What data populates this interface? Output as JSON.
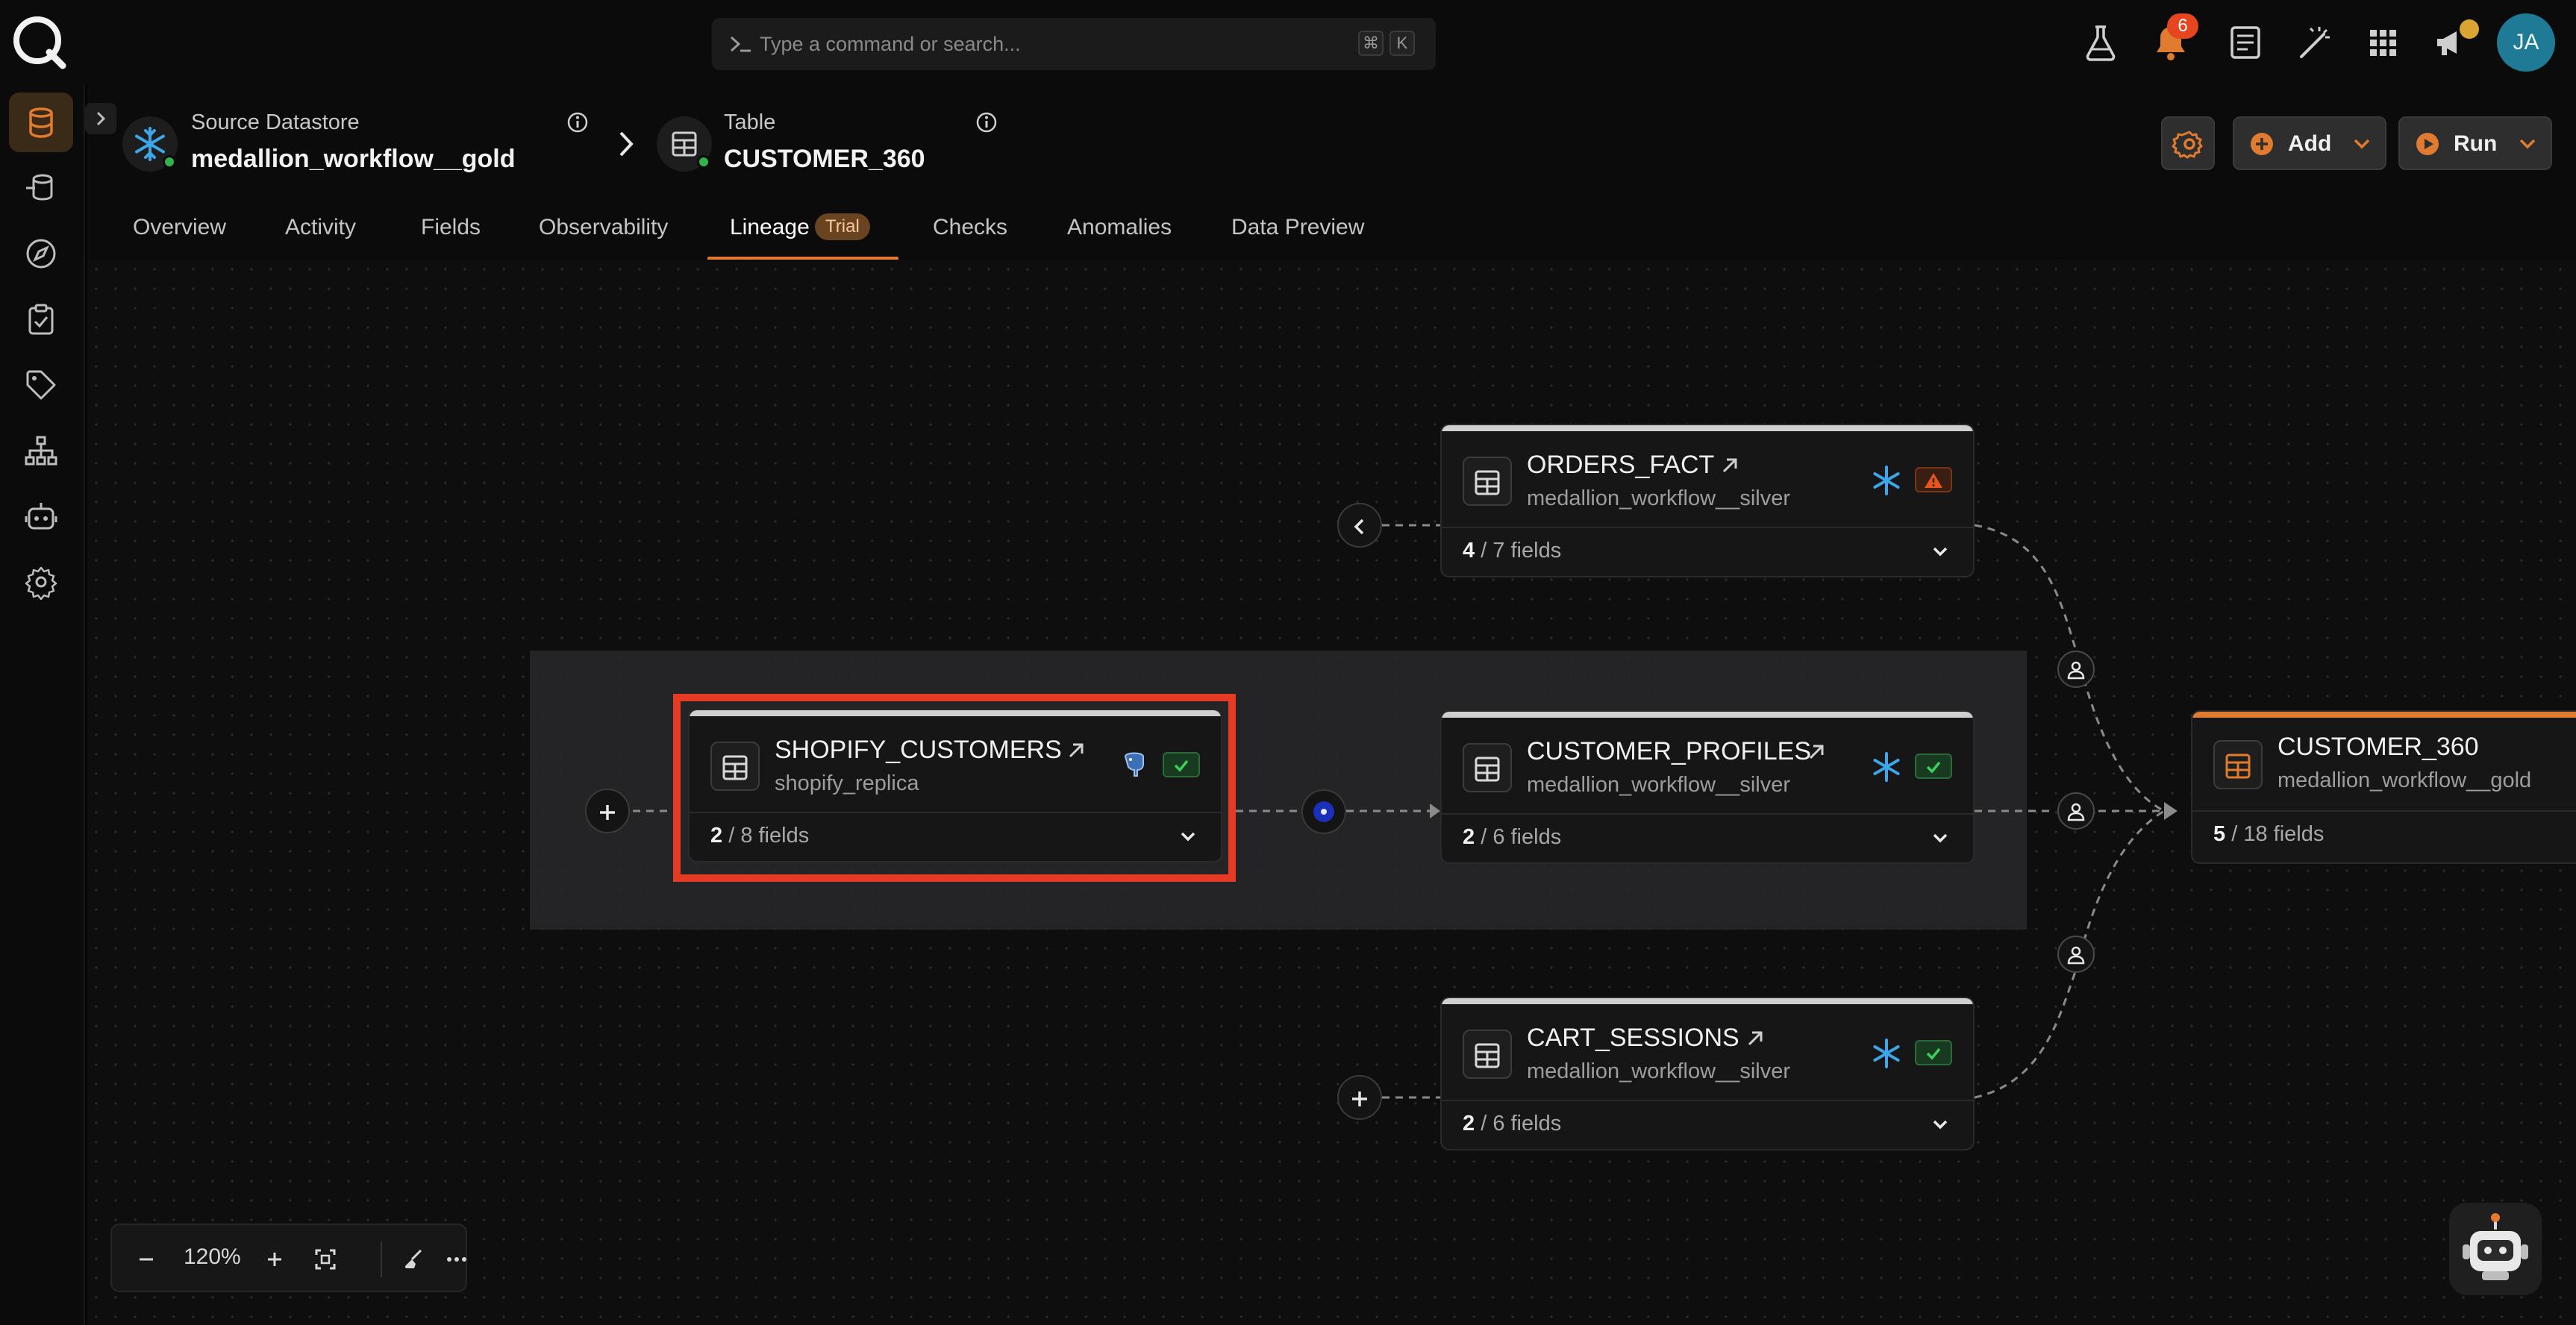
{
  "search": {
    "placeholder": "Type a command or search...",
    "shortcut_mod": "⌘",
    "shortcut_key": "K"
  },
  "notifications": {
    "count": "6"
  },
  "user": {
    "initials": "JA"
  },
  "breadcrumb": {
    "datastore": {
      "label": "Source Datastore",
      "value": "medallion_workflow__gold"
    },
    "table": {
      "label": "Table",
      "value": "CUSTOMER_360"
    }
  },
  "actions": {
    "add_label": "Add",
    "run_label": "Run"
  },
  "tabs": [
    {
      "label": "Overview"
    },
    {
      "label": "Activity"
    },
    {
      "label": "Fields"
    },
    {
      "label": "Observability"
    },
    {
      "label": "Lineage",
      "badge": "Trial",
      "active": true
    },
    {
      "label": "Checks"
    },
    {
      "label": "Anomalies"
    },
    {
      "label": "Data Preview"
    }
  ],
  "nodes": {
    "orders_fact": {
      "name": "ORDERS_FACT",
      "source": "medallion_workflow__silver",
      "fields_active": "4",
      "fields_total": "/ 7 fields",
      "status": "warning"
    },
    "shopify_customers": {
      "name": "SHOPIFY_CUSTOMERS",
      "source": "shopify_replica",
      "fields_active": "2",
      "fields_total": "/ 8 fields",
      "status": "ok"
    },
    "customer_profiles": {
      "name": "CUSTOMER_PROFILES",
      "source": "medallion_workflow__silver",
      "fields_active": "2",
      "fields_total": "/ 6 fields",
      "status": "ok"
    },
    "cart_sessions": {
      "name": "CART_SESSIONS",
      "source": "medallion_workflow__silver",
      "fields_active": "2",
      "fields_total": "/ 6 fields",
      "status": "ok"
    },
    "customer_360": {
      "name": "CUSTOMER_360",
      "source": "medallion_workflow__gold",
      "fields_active": "5",
      "fields_total": "/ 18 fields"
    }
  },
  "zoom": {
    "level": "120%"
  },
  "colors": {
    "accent": "#e07b2f",
    "highlight": "#e53a24",
    "ok": "#2fb34a",
    "snowflake": "#3ca6e8"
  }
}
